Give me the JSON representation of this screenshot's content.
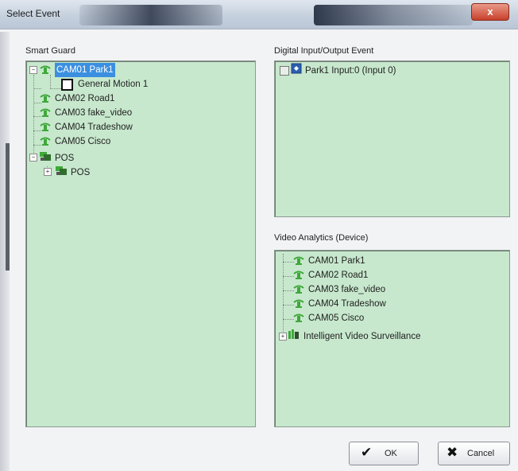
{
  "window": {
    "title": "Select Event",
    "close_glyph": "x"
  },
  "smart_guard": {
    "label": "Smart Guard",
    "items": [
      {
        "label": "CAM01 Park1",
        "icon": "camera-icon",
        "selected": true
      },
      {
        "label": "General Motion 1",
        "icon": "checkbox-icon"
      },
      {
        "label": "CAM02 Road1",
        "icon": "camera-icon"
      },
      {
        "label": "CAM03 fake_video",
        "icon": "camera-icon"
      },
      {
        "label": "CAM04 Tradeshow",
        "icon": "camera-icon"
      },
      {
        "label": "CAM05 Cisco",
        "icon": "camera-icon"
      },
      {
        "label": "POS",
        "icon": "pos-group-icon"
      },
      {
        "label": "POS",
        "icon": "pos-icon"
      }
    ]
  },
  "digital_io": {
    "label": "Digital Input/Output Event",
    "items": [
      {
        "label": "Park1 Input:0 (Input 0)",
        "icon": "digital-input-icon"
      }
    ]
  },
  "video_analytics": {
    "label": "Video Analytics (Device)",
    "items": [
      {
        "label": "CAM01 Park1",
        "icon": "camera-icon"
      },
      {
        "label": "CAM02 Road1",
        "icon": "camera-icon"
      },
      {
        "label": "CAM03 fake_video",
        "icon": "camera-icon"
      },
      {
        "label": "CAM04 Tradeshow",
        "icon": "camera-icon"
      },
      {
        "label": "CAM05 Cisco",
        "icon": "camera-icon"
      },
      {
        "label": "Intelligent Video Surveillance",
        "icon": "ivs-icon"
      }
    ]
  },
  "buttons": {
    "ok_label": "OK",
    "cancel_label": "Cancel"
  },
  "colors": {
    "panel_bg": "#c7e8cd",
    "selection": "#3b8fe0",
    "camera_green": "#3fa83a"
  }
}
